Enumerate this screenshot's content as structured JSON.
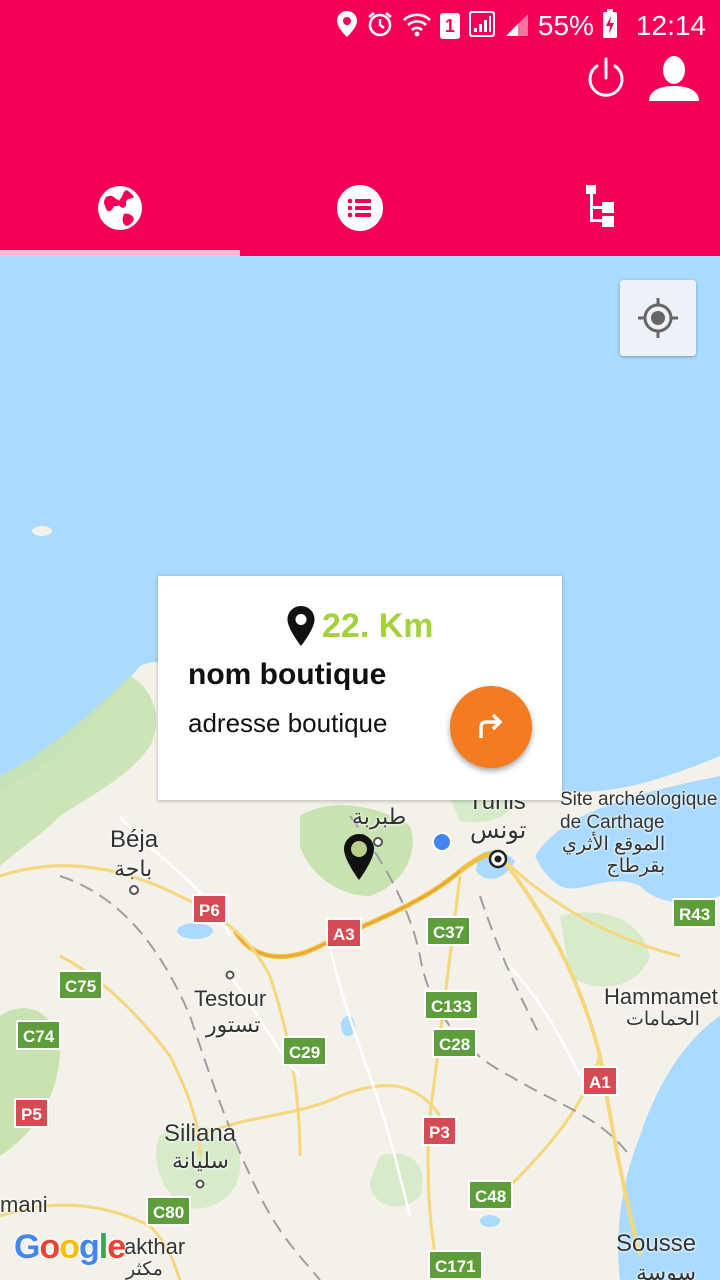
{
  "status_bar": {
    "battery_text": "55%",
    "time": "12:14",
    "sim_badge": "1",
    "icons": [
      "location-icon",
      "alarm-icon",
      "wifi-icon",
      "sim-icon",
      "signal-icon",
      "signal-icon",
      "battery-charging-icon"
    ]
  },
  "header": {
    "color": "#F50057",
    "actions": [
      {
        "name": "power-button",
        "icon": "power-icon"
      },
      {
        "name": "profile-button",
        "icon": "person-icon"
      }
    ],
    "tabs": [
      {
        "name": "tab-map",
        "icon": "globe-icon",
        "active": true
      },
      {
        "name": "tab-list",
        "icon": "list-icon",
        "active": false
      },
      {
        "name": "tab-tree",
        "icon": "tree-structure-icon",
        "active": false
      }
    ]
  },
  "map": {
    "provider_logo": "Google",
    "labels": {
      "tabarka_ar": "طبربة",
      "tunis": "Tunis",
      "tunis_ar": "تونس",
      "carthage": "Site archéologique\nde Carthage",
      "carthage_ar": "الموقع الأثري\nبقرطاج",
      "beja": "Béja",
      "beja_ar": "باجة",
      "testour": "Testour",
      "testour_ar": "تستور",
      "hammamet": "Hammamet",
      "hammamet_ar": "الحمامات",
      "siliana": "Siliana",
      "siliana_ar": "سليانة",
      "sousse": "Sousse",
      "sousse_ar": "سوسة",
      "makthar": "akthar",
      "makthar_ar": "مكثر",
      "mani": "mani"
    },
    "roads": {
      "p6": "P6",
      "a3": "A3",
      "c37": "C37",
      "r43": "R43",
      "c75": "C75",
      "c74": "C74",
      "c133": "C133",
      "c28": "C28",
      "c29": "C29",
      "a1": "A1",
      "p5": "P5",
      "p3": "P3",
      "c48": "C48",
      "c80": "C80",
      "c171": "C171"
    }
  },
  "info_window": {
    "distance": "22. Km",
    "shop_name": "nom boutique",
    "shop_address": "adresse boutique",
    "accent_color": "#A4D23C",
    "fab_color": "#F47C20"
  }
}
